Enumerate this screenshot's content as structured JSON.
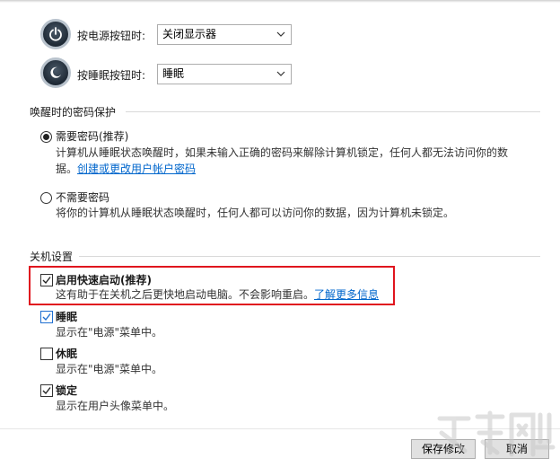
{
  "power_buttons": {
    "power_label": "按电源按钮时:",
    "power_value": "关闭显示器",
    "sleep_label": "按睡眠按钮时:",
    "sleep_value": "睡眠"
  },
  "wake_password": {
    "title": "唤醒时的密码保护",
    "require": {
      "label": "需要密码(推荐)",
      "selected": true,
      "desc_line1": "计算机从睡眠状态唤醒时，如果未输入正确的密码来解除计算机锁定，任何人都无法访问你的数",
      "desc_line2_prefix": "据。",
      "link": "创建或更改用户帐户密码"
    },
    "no_require": {
      "label": "不需要密码",
      "selected": false,
      "desc": "将你的计算机从睡眠状态唤醒时，任何人都可以访问你的数据，因为计算机未锁定。"
    }
  },
  "shutdown": {
    "title": "关机设置",
    "fast_startup": {
      "label": "启用快速启动(推荐)",
      "checked": true,
      "desc": "这有助于在关机之后更快地启动电脑。不会影响重启。",
      "link": "了解更多信息"
    },
    "sleep": {
      "label": "睡眠",
      "checked": true,
      "desc": "显示在\"电源\"菜单中。"
    },
    "hibernate": {
      "label": "休眠",
      "checked": false,
      "desc": "显示在\"电源\"菜单中。"
    },
    "lock": {
      "label": "锁定",
      "checked": true,
      "desc": "显示在用户头像菜单中。"
    }
  },
  "buttons": {
    "save": "保存修改",
    "cancel": "取消"
  },
  "colors": {
    "highlight": "#e0141e",
    "link": "#0066cc",
    "checkbox_blue": "#1f6fd1"
  }
}
